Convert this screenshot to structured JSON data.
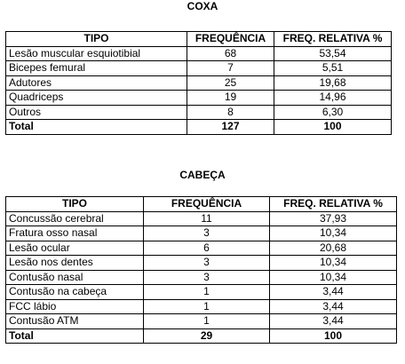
{
  "coxa": {
    "title": "COXA",
    "headers": [
      "TIPO",
      "FREQUÊNCIA",
      "FREQ. RELATIVA %"
    ],
    "rows": [
      [
        "Lesão muscular esquiotibial",
        "68",
        "53,54"
      ],
      [
        "Bicepes femural",
        "7",
        "5,51"
      ],
      [
        "Adutores",
        "25",
        "19,68"
      ],
      [
        "Quadriceps",
        "19",
        "14,96"
      ],
      [
        "Outros",
        "8",
        "6,30"
      ]
    ],
    "total": [
      "Total",
      "127",
      "100"
    ]
  },
  "cabeca": {
    "title": "CABEÇA",
    "headers": [
      "TIPO",
      "FREQUÊNCIA",
      "FREQ. RELATIVA %"
    ],
    "rows": [
      [
        "Concussão cerebral",
        "11",
        "37,93"
      ],
      [
        "Fratura osso nasal",
        "3",
        "10,34"
      ],
      [
        "Lesão ocular",
        "6",
        "20,68"
      ],
      [
        "Lesão nos dentes",
        "3",
        "10,34"
      ],
      [
        "Contusão nasal",
        "3",
        "10,34"
      ],
      [
        "Contusão na cabeça",
        "1",
        "3,44"
      ],
      [
        "FCC lábio",
        "1",
        "3,44"
      ],
      [
        "Contusão ATM",
        "1",
        "3,44"
      ]
    ],
    "total": [
      "Total",
      "29",
      "100"
    ]
  }
}
